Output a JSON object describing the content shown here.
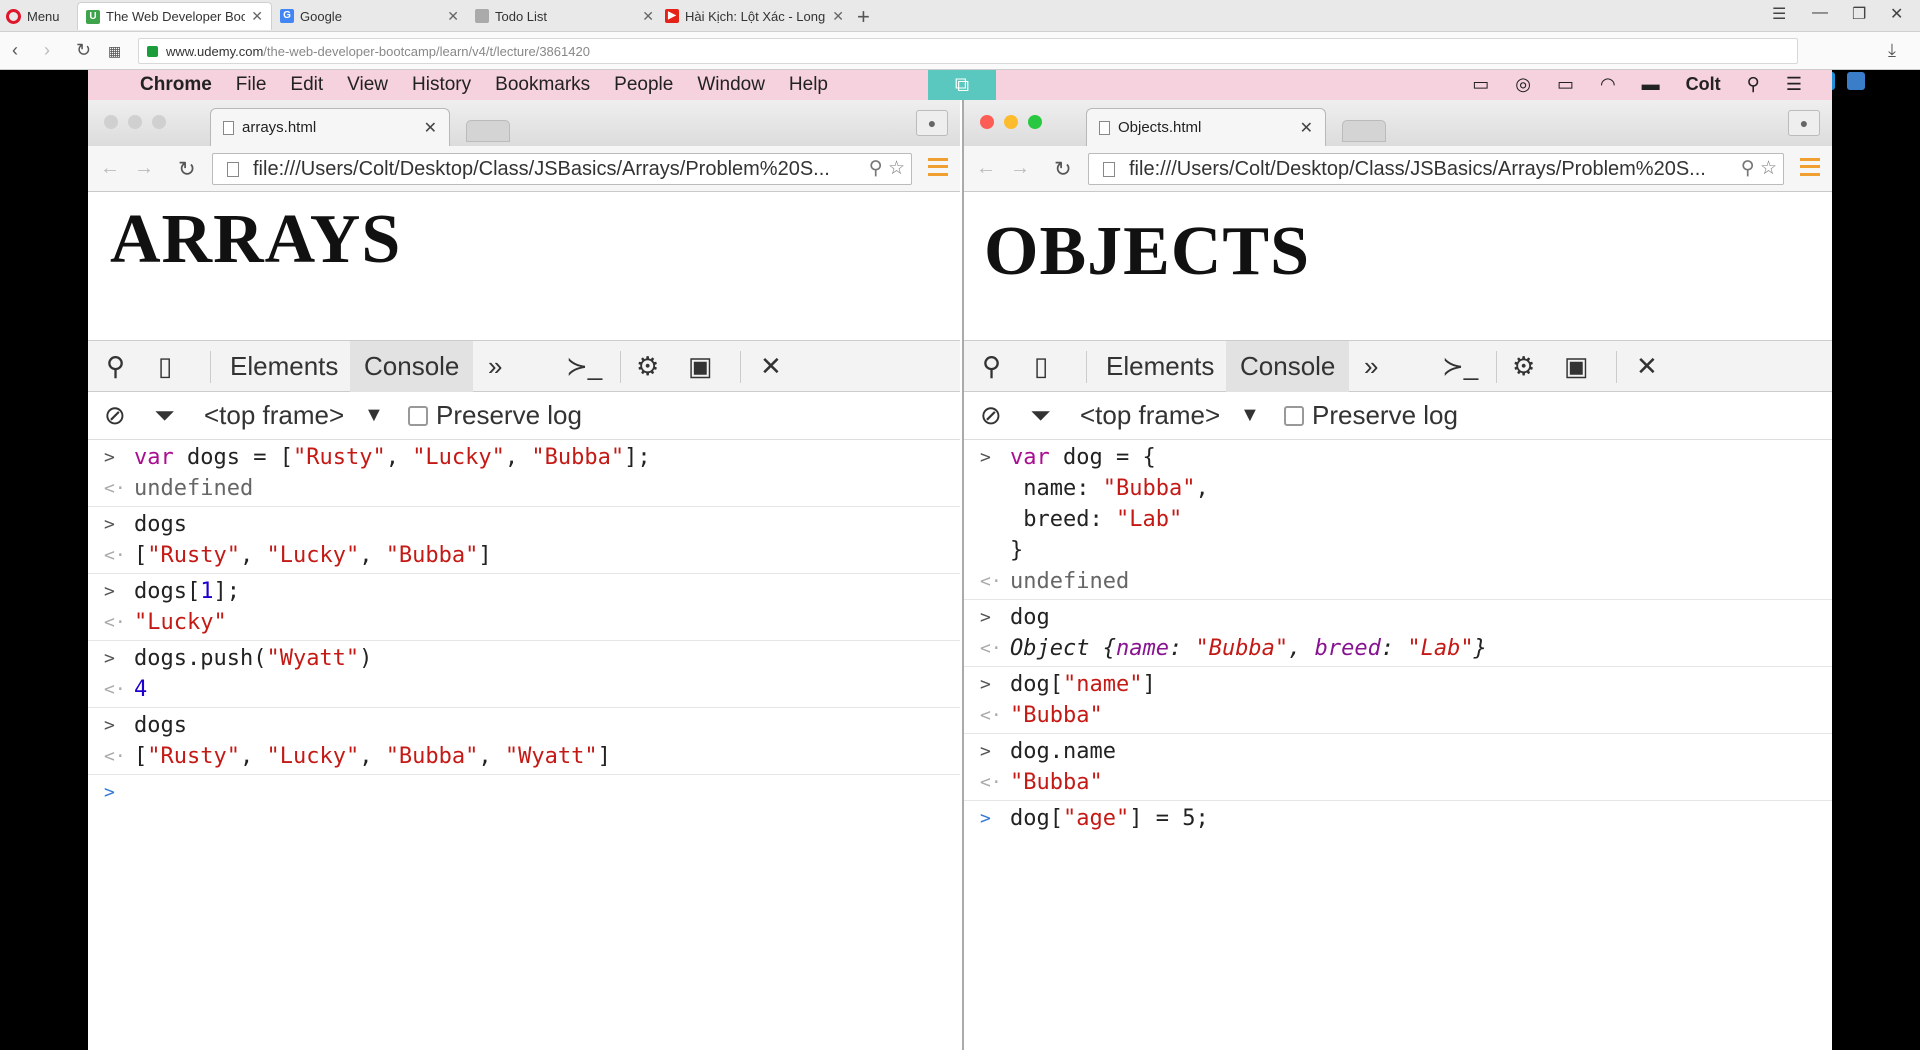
{
  "outer_browser": {
    "menu_label": "Menu",
    "tabs": [
      {
        "title": "The Web Developer Bootc",
        "active": true
      },
      {
        "title": "Google",
        "active": false
      },
      {
        "title": "Todo List",
        "active": false
      },
      {
        "title": "Hài Kịch: Lột Xác - Long H",
        "active": false
      }
    ],
    "url_domain": "www.udemy.com",
    "url_path": "/the-web-developer-bootcamp/learn/v4/t/lecture/3861420"
  },
  "mac_menubar": {
    "items": [
      "Chrome",
      "File",
      "Edit",
      "View",
      "History",
      "Bookmarks",
      "People",
      "Window",
      "Help"
    ],
    "user": "Colt"
  },
  "left_window": {
    "tab_title": "arrays.html",
    "url": "file:///Users/Colt/Desktop/Class/JSBasics/Arrays/Problem%20S...",
    "heading": "ARRAYS",
    "devtools": {
      "elements": "Elements",
      "console": "Console",
      "frame": "<top frame>",
      "preserve": "Preserve log"
    }
  },
  "right_window": {
    "tab_title": "Objects.html",
    "url": "file:///Users/Colt/Desktop/Class/JSBasics/Arrays/Problem%20S...",
    "heading": "OBJECTS",
    "devtools": {
      "elements": "Elements",
      "console": "Console",
      "frame": "<top frame>",
      "preserve": "Preserve log"
    }
  },
  "colors": {
    "keyword": "#aa0d91",
    "string": "#c41a16",
    "number": "#1c00cf",
    "menubar": "#f6d1de"
  },
  "icons": [
    "opera-icon",
    "search-icon",
    "mobile-icon",
    "more-tabs-icon",
    "drawer-icon",
    "gear-icon",
    "dock-icon",
    "close-icon",
    "clear-icon",
    "filter-icon"
  ]
}
